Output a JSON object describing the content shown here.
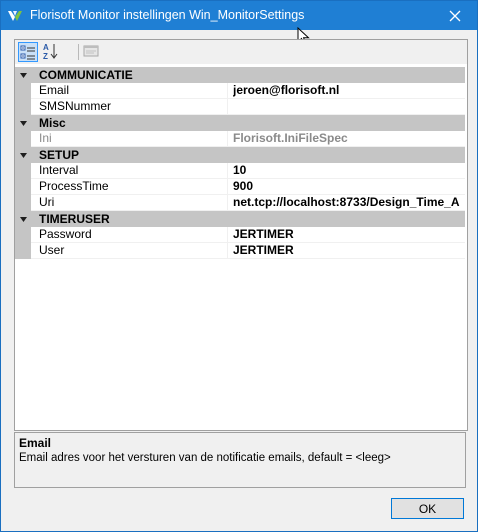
{
  "window": {
    "title": "Florisoft Monitor instellingen Win_MonitorSettings",
    "icons": {
      "app": "florisoft-logo-icon",
      "close": "close-icon"
    }
  },
  "toolbar": {
    "buttons": [
      "categorized-icon",
      "alphabetical-sort-icon",
      "property-pages-icon"
    ]
  },
  "grid": {
    "categories": [
      {
        "name": "COMMUNICATIE",
        "properties": [
          {
            "name": "Email",
            "value": "jeroen@florisoft.nl"
          },
          {
            "name": "SMSNummer",
            "value": ""
          }
        ]
      },
      {
        "name": "Misc",
        "properties": [
          {
            "name": "Ini",
            "value": "Florisoft.IniFileSpec",
            "disabled": true
          }
        ]
      },
      {
        "name": "SETUP",
        "properties": [
          {
            "name": "Interval",
            "value": "10"
          },
          {
            "name": "ProcessTime",
            "value": "900"
          },
          {
            "name": "Uri",
            "value": "net.tcp://localhost:8733/Design_Time_A"
          }
        ]
      },
      {
        "name": "TIMERUSER",
        "properties": [
          {
            "name": "Password",
            "value": "JERTIMER"
          },
          {
            "name": "User",
            "value": "JERTIMER"
          }
        ]
      }
    ]
  },
  "description": {
    "title": "Email",
    "text": "Email adres voor het versturen van de notificatie emails, default = <leeg>"
  },
  "ok_label": "OK"
}
